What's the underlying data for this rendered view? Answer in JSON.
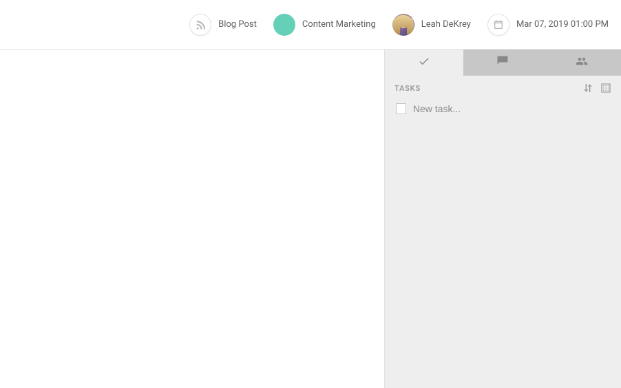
{
  "header": {
    "type": {
      "icon": "rss-icon",
      "label": "Blog Post"
    },
    "category": {
      "label": "Content Marketing"
    },
    "owner": {
      "label": "Leah DeKrey"
    },
    "date": {
      "icon": "calendar-icon",
      "label": "Mar 07, 2019 01:00 PM"
    }
  },
  "sidebar": {
    "tabs": {
      "tasks_icon": "check-icon",
      "comments_icon": "comment-icon",
      "team_icon": "team-icon"
    },
    "panel_title": "TASKS",
    "sort_icon": "sort-icon",
    "templates_icon": "grid-icon",
    "new_task_placeholder": "New task..."
  }
}
